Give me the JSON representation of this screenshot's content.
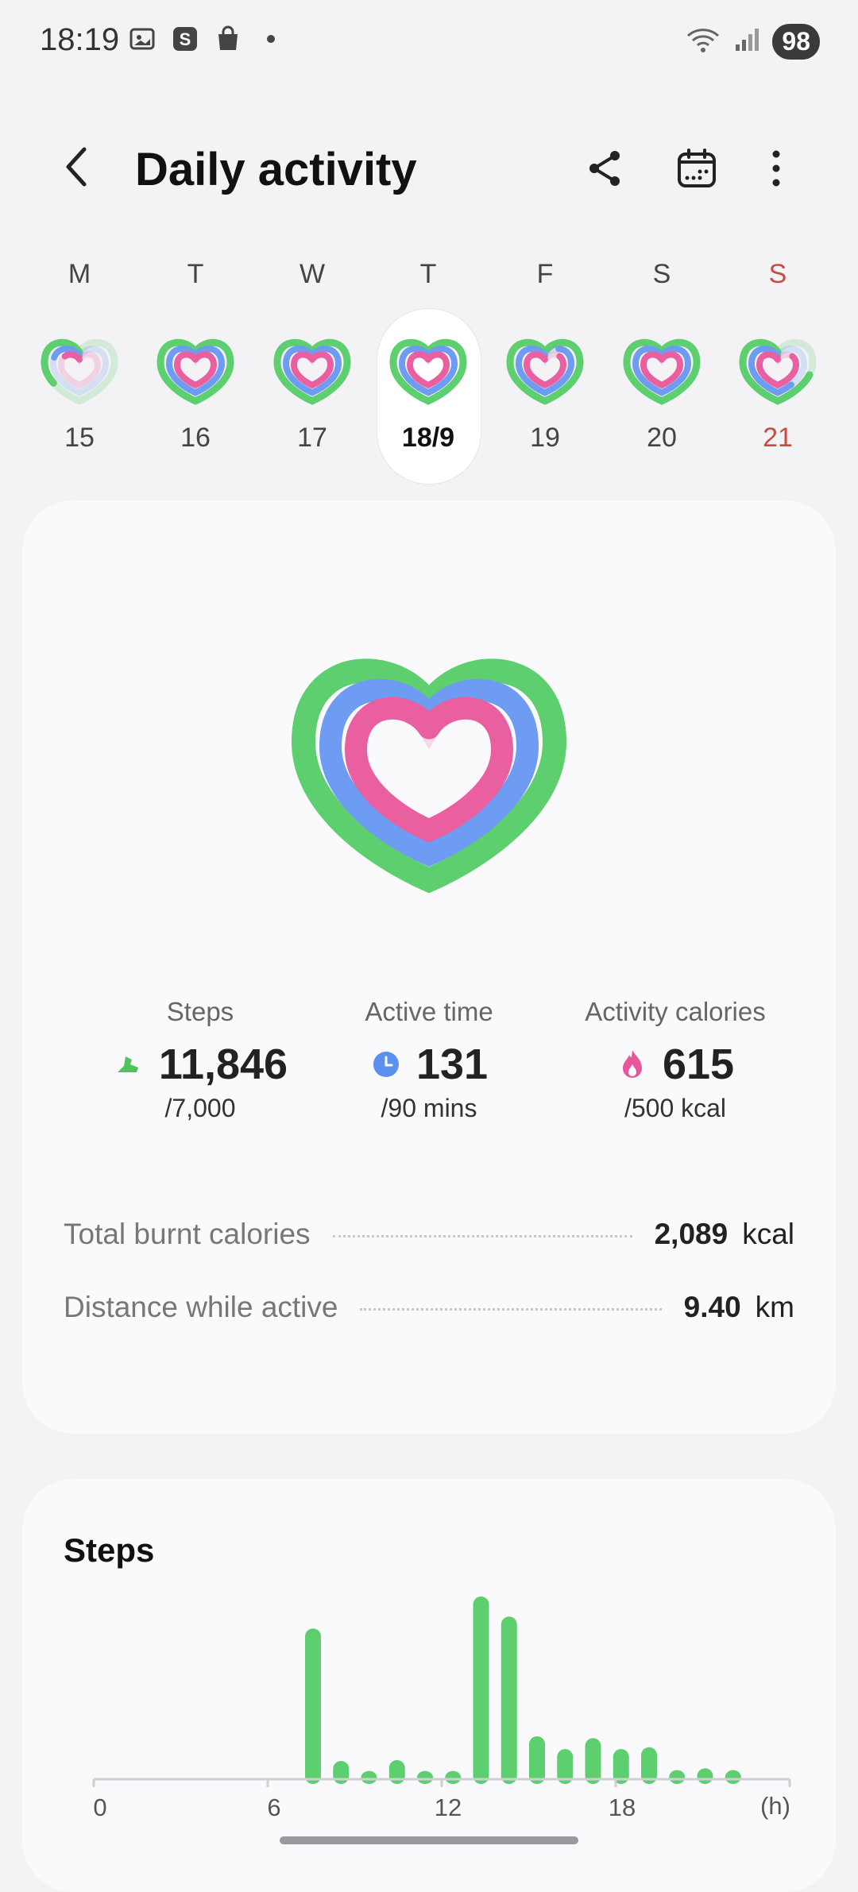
{
  "status_bar": {
    "time": "18:19",
    "battery": "98",
    "icons": [
      "screenshot-icon",
      "s-app-icon",
      "shopping-bag-icon",
      "dot-icon",
      "wifi-icon",
      "signal-icon"
    ]
  },
  "header": {
    "title": "Daily activity",
    "back_icon": "chevron-left-icon",
    "share_icon": "share-icon",
    "calendar_icon": "calendar-icon",
    "more_icon": "more-vertical-icon"
  },
  "week": [
    {
      "letter": "M",
      "date": "15",
      "progress": {
        "move": 0.35,
        "active": 0.2,
        "cal": 0.15
      }
    },
    {
      "letter": "T",
      "date": "16",
      "progress": {
        "move": 1,
        "active": 1,
        "cal": 1
      }
    },
    {
      "letter": "W",
      "date": "17",
      "progress": {
        "move": 1,
        "active": 1,
        "cal": 1
      }
    },
    {
      "letter": "T",
      "date": "18/9",
      "selected": true,
      "progress": {
        "move": 1,
        "active": 1,
        "cal": 1
      }
    },
    {
      "letter": "F",
      "date": "19",
      "progress": {
        "move": 1,
        "active": 0.9,
        "cal": 0.85
      }
    },
    {
      "letter": "S",
      "date": "20",
      "progress": {
        "move": 1,
        "active": 1,
        "cal": 1
      }
    },
    {
      "letter": "S",
      "date": "21",
      "sunday": true,
      "progress": {
        "move": 0.7,
        "active": 0.6,
        "cal": 0.85
      }
    }
  ],
  "summary": {
    "stats": [
      {
        "label": "Steps",
        "value": "11,846",
        "goal": "/7,000",
        "icon": "shoe-icon",
        "color": "#4fc35e"
      },
      {
        "label": "Active time",
        "value": "131",
        "goal": "/90 mins",
        "icon": "clock-icon",
        "color": "#5b8ff0"
      },
      {
        "label": "Activity calories",
        "value": "615",
        "goal": "/500 kcal",
        "icon": "flame-icon",
        "color": "#e8579c"
      }
    ],
    "metrics": [
      {
        "label": "Total burnt calories",
        "value": "2,089",
        "unit": "kcal"
      },
      {
        "label": "Distance while active",
        "value": "9.40",
        "unit": "km"
      }
    ],
    "ring_colors": {
      "move": "#5ecf6e",
      "active": "#6d9cf2",
      "calories": "#ea5fa0"
    }
  },
  "steps_card": {
    "title": "Steps",
    "chart_data": {
      "type": "bar",
      "x_ticks": [
        "0",
        "6",
        "12",
        "18"
      ],
      "x_unit": "(h)",
      "categories": [
        "0",
        "1",
        "2",
        "3",
        "4",
        "5",
        "6",
        "7",
        "8",
        "9",
        "10",
        "11",
        "12",
        "13",
        "14",
        "15",
        "16",
        "17",
        "18",
        "19",
        "20",
        "21",
        "22",
        "23"
      ],
      "values": [
        0,
        0,
        0,
        0,
        0,
        0,
        0,
        1650,
        200,
        90,
        210,
        90,
        90,
        2000,
        1780,
        470,
        330,
        450,
        330,
        350,
        100,
        120,
        100,
        0
      ],
      "color": "#5ecf6e",
      "grid": false
    }
  }
}
